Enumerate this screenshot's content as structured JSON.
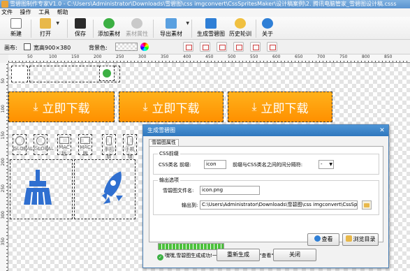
{
  "window": {
    "title": "雪碧图制作专家V1.0 - C:\\Users\\Administrator\\Downloads\\雪碧图\\css imgconvert\\CssSpritesMaker\\设计稿案例\\2. 腾讯电脑管家_雪碧图设计稿.csss"
  },
  "menu": [
    "文件",
    "操作",
    "工具",
    "帮助"
  ],
  "toolbar": {
    "new": "新建",
    "open": "打开",
    "save": "保存",
    "add": "添加素材",
    "props": "素材属性",
    "export": "导出素材",
    "generate": "生成雪碧图",
    "history": "历史轮训",
    "about": "关于"
  },
  "canvas_bar": {
    "canvas_label": "画布:",
    "size": "宽高900×380",
    "bg_label": "背景色:"
  },
  "ruler": {
    "h": [
      "50",
      "100",
      "150",
      "200",
      "250",
      "300",
      "350",
      "400",
      "450",
      "500",
      "550",
      "600",
      "650",
      "700",
      "750",
      "800",
      "850"
    ],
    "v": [
      "50",
      "100",
      "150",
      "200",
      "250",
      "300",
      "350"
    ]
  },
  "sprites": {
    "download_label": "立即下载",
    "small": [
      "GLOBAL",
      "GLOBAL",
      "MAC版",
      "MAC版",
      "手机版",
      "手机版"
    ]
  },
  "dialog": {
    "title": "生成雪碧图",
    "tab": "雪碧图属性",
    "css_group": "CSS前缀",
    "css_prefix_label": "CSS类名 前缀:",
    "css_prefix_value": "icon",
    "sep_label": "前缀与CSS类名之间的间分隔符:",
    "sep_value": "-",
    "out_group": "输出选项",
    "filename_label": "雪碧图文件名:",
    "filename_value": "icon.png",
    "output_label": "输出到:",
    "output_value": "C:\\Users\\Administrator\\Downloads\\雪碧图\\css imgconvert\\CssSpritesM",
    "progress": 1.0,
    "status": "嘿嘿,雪碧图生成成功!一共16个素材,请点击\"查看\"",
    "view": "查看",
    "browse": "浏览目录",
    "regen": "重新生成",
    "close": "关闭"
  },
  "colors": {
    "orange": "#ff9a0d",
    "blue_icon": "#2f6fd0",
    "dialog_title": "#3a82c8",
    "green": "#4cc13c"
  }
}
